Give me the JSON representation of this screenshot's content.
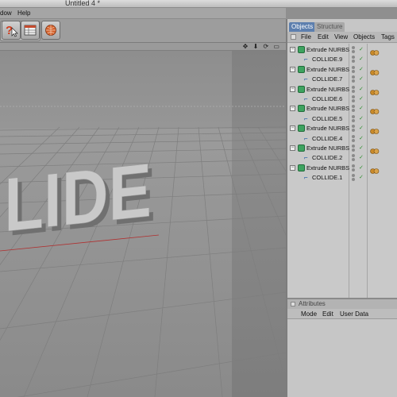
{
  "window": {
    "title": "Untitled 4 *"
  },
  "menu": {
    "items": [
      "dow",
      "Help"
    ]
  },
  "toolbar": {
    "buttons": [
      {
        "icon": "help-cursor-icon"
      },
      {
        "icon": "render-settings-icon"
      },
      {
        "icon": "render-sphere-icon"
      }
    ]
  },
  "viewport": {
    "nav_icons": "✥ ⬇ ⟳ ▭",
    "scene_text": "LIDE"
  },
  "objects_panel": {
    "tabs": [
      "Objects",
      "Structure"
    ],
    "menu": [
      "File",
      "Edit",
      "View",
      "Objects",
      "Tags"
    ],
    "rows": [
      {
        "label": "Extrude NURBS",
        "level": 0
      },
      {
        "label": "COLLIDE.9",
        "level": 1
      },
      {
        "label": "Extrude NURBS",
        "level": 0
      },
      {
        "label": "COLLIDE.7",
        "level": 1
      },
      {
        "label": "Extrude NURBS",
        "level": 0
      },
      {
        "label": "COLLIDE.6",
        "level": 1
      },
      {
        "label": "Extrude NURBS",
        "level": 0
      },
      {
        "label": "COLLIDE.5",
        "level": 1
      },
      {
        "label": "Extrude NURBS",
        "level": 0
      },
      {
        "label": "COLLIDE.4",
        "level": 1
      },
      {
        "label": "Extrude NURBS",
        "level": 0
      },
      {
        "label": "COLLIDE.2",
        "level": 1
      },
      {
        "label": "Extrude NURBS",
        "level": 0
      },
      {
        "label": "COLLIDE.1",
        "level": 1
      }
    ]
  },
  "attributes_panel": {
    "title": "Attributes",
    "menu": [
      "Mode",
      "Edit",
      "User Data"
    ]
  },
  "colors": {
    "active_tab": "#5d7fae",
    "object_icon": "#3da35f",
    "spline_icon": "#1d5aa8"
  }
}
